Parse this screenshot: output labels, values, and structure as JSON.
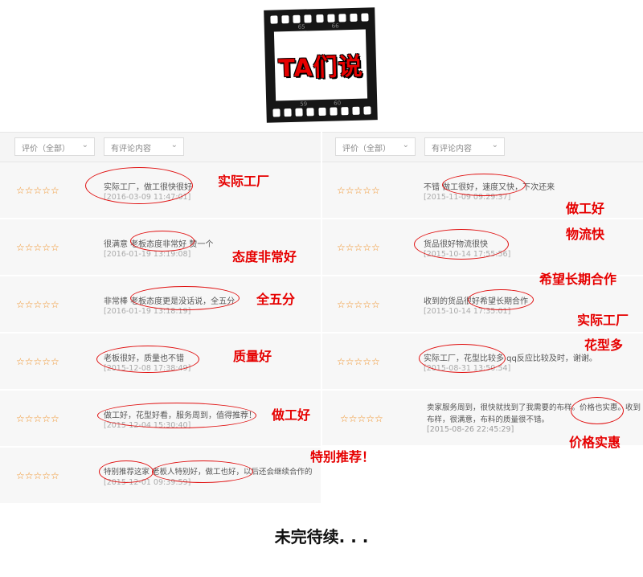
{
  "badge": {
    "title": "TA们说",
    "film_numbers": [
      "65",
      "66",
      "59",
      "60"
    ]
  },
  "left": {
    "filter": {
      "rating": "评价（全部）",
      "content": "有评论内容"
    },
    "reviews": [
      {
        "stars": "☆☆☆☆☆",
        "text": "实际工厂，做工很快很好",
        "date": "[2016-03-09 11:47:01]"
      },
      {
        "stars": "☆☆☆☆☆",
        "text": "很满意 老板态度非常好 赞一个",
        "date": "[2016-01-19 13:19:08]"
      },
      {
        "stars": "☆☆☆☆☆",
        "text": "非常棒  老板态度更是没话说，全五分",
        "date": "[2016-01-19 13:18:19]"
      },
      {
        "stars": "☆☆☆☆☆",
        "text": "老板很好，质量也不错",
        "date": "[2015-12-08 17:38:49]"
      },
      {
        "stars": "☆☆☆☆☆",
        "text": "做工好，花型好看，服务周到，值得推荐！",
        "date": "[2015-12-04 15:30:40]"
      },
      {
        "stars": "☆☆☆☆☆",
        "text": "特别推荐这家  老板人特别好，做工也好，以后还会继续合作的",
        "date": "[2015-12-01 09:39:59]"
      }
    ]
  },
  "right": {
    "filter": {
      "rating": "评价（全部）",
      "content": "有评论内容"
    },
    "reviews": [
      {
        "stars": "☆☆☆☆☆",
        "text": "不错  做工很好，速度又快，下次还来",
        "date": "[2015-11-09 09:29:37]"
      },
      {
        "stars": "☆☆☆☆☆",
        "text": "货品很好物流很快",
        "date": "[2015-10-14 17:55:56]"
      },
      {
        "stars": "☆☆☆☆☆",
        "text": "收到的货品很好希望长期合作",
        "date": "[2015-10-14 17:35:01]"
      },
      {
        "stars": "☆☆☆☆☆",
        "text": "实际工厂，花型比较多  qq反应比较及时，谢谢。",
        "date": "[2015-08-31 13:50:54]"
      },
      {
        "stars": "☆☆☆☆☆",
        "text": "卖家服务周到，很快就找到了我需要的布样。价格也实惠。收到",
        "text2": "布样，很满意，布料的质量很不错。",
        "date": "[2015-08-26 22:45:29]"
      }
    ]
  },
  "notes": {
    "n1": "实际工厂",
    "n2": "态度非常好",
    "n3": "全五分",
    "n4": "质量好",
    "n5": "做工好",
    "n6": "特别推荐！",
    "n7": "做工好",
    "n8": "物流快",
    "n9": "希望长期合作",
    "n10": "实际工厂",
    "n11": "花型多",
    "n12": "价格实惠"
  },
  "footer": "未完待续. . ."
}
